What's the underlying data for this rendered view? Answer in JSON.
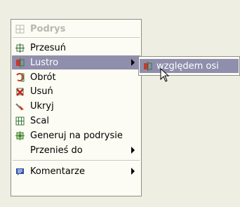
{
  "menu": {
    "header": {
      "label": "Podrys",
      "icon": "layout-grid-icon"
    },
    "items": [
      {
        "label": "Przesuń",
        "icon": "move-icon"
      },
      {
        "label": "Lustro",
        "icon": "mirror-icon",
        "has_submenu": true,
        "selected": true
      },
      {
        "label": "Obrót",
        "icon": "rotate-icon"
      },
      {
        "label": "Usuń",
        "icon": "delete-icon"
      },
      {
        "label": "Ukryj",
        "icon": "hide-icon"
      },
      {
        "label": "Scal",
        "icon": "merge-icon"
      },
      {
        "label": "Generuj na podrysie",
        "icon": "generate-icon"
      },
      {
        "label": "Przenieś do",
        "has_submenu": true
      }
    ],
    "footer_item": {
      "label": "Komentarze",
      "icon": "comment-icon",
      "has_submenu": true
    }
  },
  "submenu": {
    "items": [
      {
        "label": "względem osi",
        "icon": "mirror-icon",
        "selected": true
      }
    ]
  },
  "colors": {
    "selection": "#8f8eac",
    "menu_bg": "#fcfcf4",
    "page_bg": "#eeeee3",
    "disabled_text": "#b7b7ae"
  }
}
